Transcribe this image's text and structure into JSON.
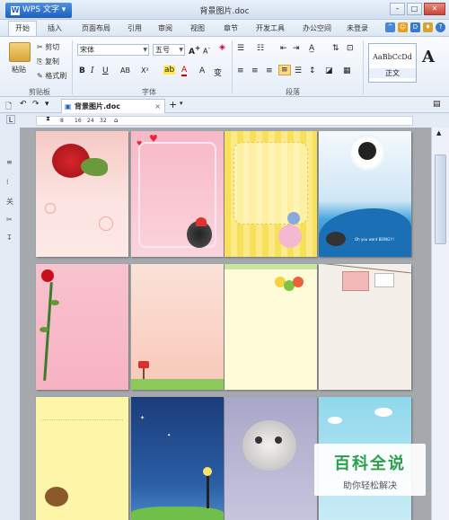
{
  "app": {
    "button_label": "WPS 文字",
    "doc_title": "背景图片.doc"
  },
  "menu_tabs": [
    {
      "label": "开始",
      "active": true
    },
    {
      "label": "插入"
    },
    {
      "label": "页面布局"
    },
    {
      "label": "引用"
    },
    {
      "label": "审阅"
    },
    {
      "label": "视图"
    },
    {
      "label": "章节"
    },
    {
      "label": "开发工具"
    },
    {
      "label": "办公空间"
    }
  ],
  "account": {
    "status": "未登录"
  },
  "ribbon": {
    "clipboard": {
      "paste": "粘贴",
      "cut": "剪切",
      "copy": "复制",
      "format_painter": "格式刷",
      "group_label": "剪贴板"
    },
    "font": {
      "font_name": "宋体",
      "font_size": "五号",
      "group_label": "字体"
    },
    "paragraph": {
      "group_label": "段落"
    },
    "styles": {
      "sample": "AaBbCcDd",
      "style_name": "正文",
      "big_a": "A"
    }
  },
  "doc_tab": {
    "label": "背景图片.doc",
    "close": "×",
    "add": "+"
  },
  "ruler": {
    "numbers": [
      "8",
      "16",
      "24",
      "32"
    ]
  },
  "left_strip": [
    "≡",
    "⁞",
    "关",
    "✂",
    "↧"
  ],
  "pages": [
    {
      "theme": "red-rose"
    },
    {
      "theme": "pink-hearts-frame"
    },
    {
      "theme": "yellow-stripes-cartoon"
    },
    {
      "theme": "blue-wave-boy",
      "caption": "Oh you want BEING!!!"
    },
    {
      "theme": "pink-rose-vine"
    },
    {
      "theme": "peach-gradient-mailbox"
    },
    {
      "theme": "cream-fruit"
    },
    {
      "theme": "cream-letter-strings"
    },
    {
      "theme": "yellow-bear"
    },
    {
      "theme": "night-sky-lamp"
    },
    {
      "theme": "kitten-photo"
    },
    {
      "theme": "sky-blue"
    }
  ],
  "watermark": {
    "line1": "百科全说",
    "line2": "助你轻松解决"
  },
  "colors": {
    "accent": "#1f5fbf",
    "canvas_bg": "#a5a8ad",
    "watermark_green": "#2aa04a"
  }
}
